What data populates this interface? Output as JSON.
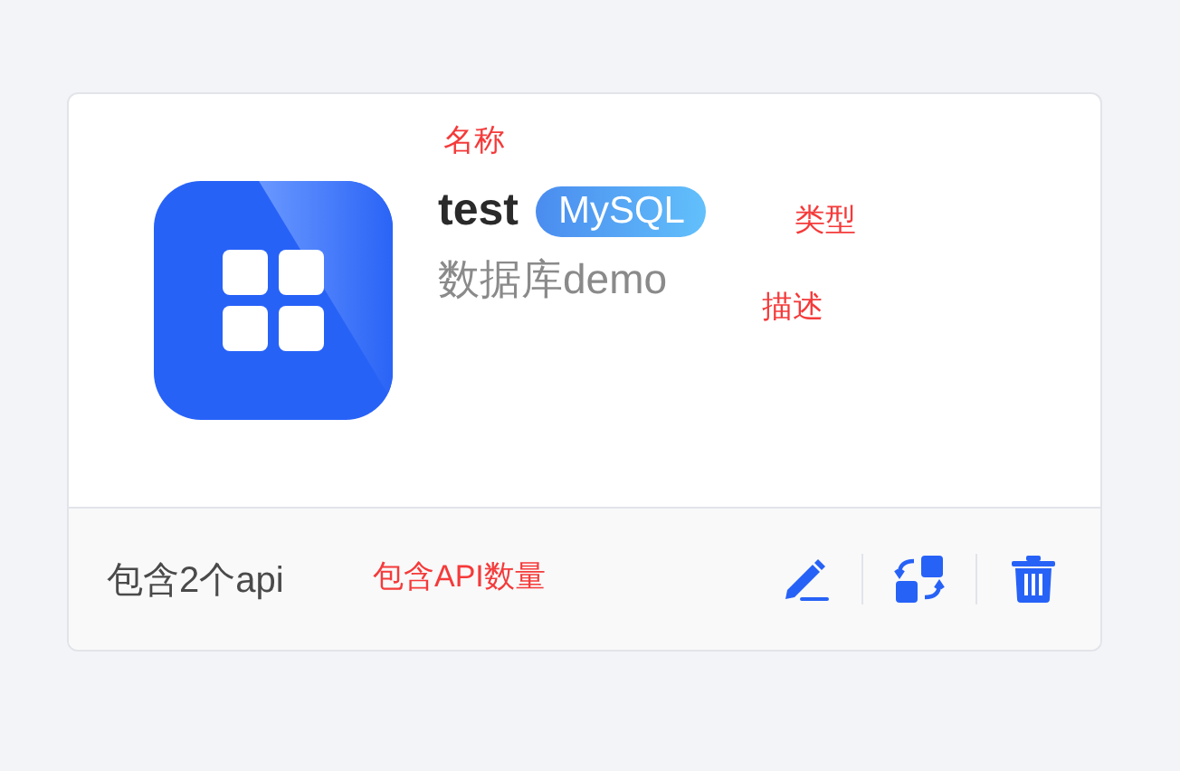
{
  "card": {
    "name": "test",
    "type_badge": "MySQL",
    "description": "数据库demo",
    "api_count": "包含2个api"
  },
  "annotations": {
    "name_note": "名称",
    "type_note": "类型",
    "description_note": "描述",
    "count_note": "包含API数量"
  }
}
